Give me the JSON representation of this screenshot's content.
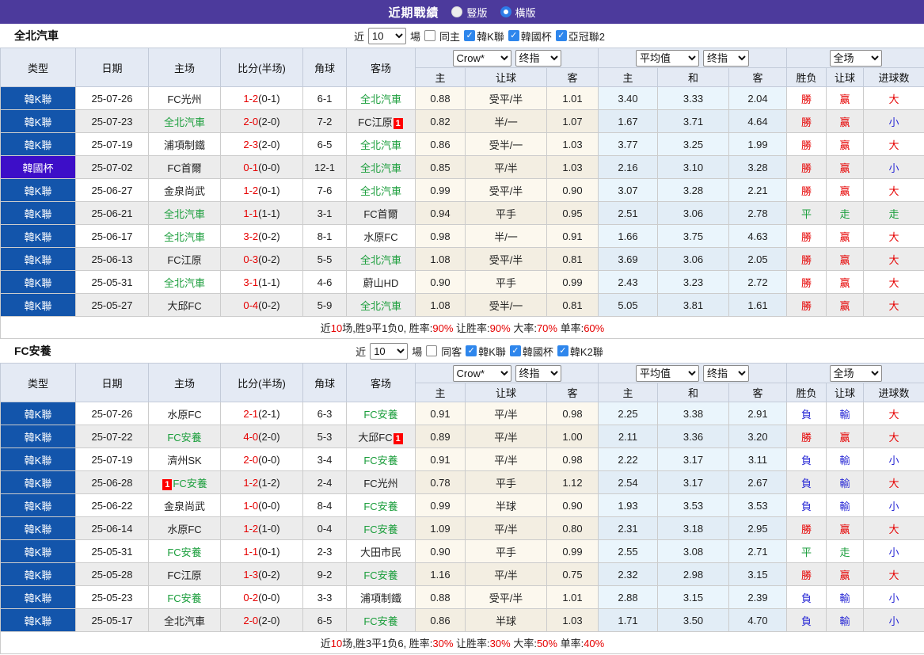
{
  "title_bar": {
    "title": "近期戰績",
    "vertical_label": "豎版",
    "horizontal_label": "橫版",
    "selected": "橫版",
    "bar_color": "#4C3A9C",
    "radio_accent": "#2D7CE8"
  },
  "selects": {
    "count": "10",
    "book": "Crow*",
    "final1": "终指",
    "avg": "平均值",
    "final2": "终指",
    "scope": "全场"
  },
  "columns": {
    "type": "类型",
    "date": "日期",
    "home": "主场",
    "score": "比分(半场)",
    "corner": "角球",
    "away": "客场",
    "sub_home": "主",
    "sub_handicap": "让球",
    "sub_away": "客",
    "sub_home2": "主",
    "sub_draw": "和",
    "sub_away2": "客",
    "sub_result": "胜负",
    "sub_hresult": "让球",
    "sub_goals": "进球数"
  },
  "colors": {
    "league_blue": "#1355AB",
    "cup_purple": "#3D0EC8",
    "win_red": "#E60000",
    "lose_blue": "#2A2AD5",
    "draw_green": "#1B9E3C",
    "handicap_col_bg": "#FCF8EE",
    "avg_col_bg": "#EAF5FC"
  },
  "tables": [
    {
      "team": "全北汽車",
      "near_label": "近",
      "games_label": "場",
      "same_label": "同主",
      "leagues": [
        "韓K聯",
        "韓國杯",
        "亞冠聯2"
      ],
      "rows": [
        {
          "league": "韓K聯",
          "date": "25-07-26",
          "home": {
            "name": "FC光州"
          },
          "score_full": "1-2",
          "score_half": "(0-1)",
          "corner": "6-1",
          "away": {
            "name": "全北汽車",
            "green": true
          },
          "crow": [
            "0.88",
            "受平/半",
            "1.01"
          ],
          "avg": [
            "3.40",
            "3.33",
            "2.04"
          ],
          "result": [
            [
              "勝",
              "r"
            ],
            [
              "赢",
              "r"
            ],
            [
              "大",
              "r"
            ]
          ]
        },
        {
          "league": "韓K聯",
          "date": "25-07-23",
          "home": {
            "name": "全北汽車",
            "green": true
          },
          "score_full": "2-0",
          "score_half": "(2-0)",
          "corner": "7-2",
          "away": {
            "name": "FC江原",
            "badge": "1",
            "badge_pos": "after"
          },
          "crow": [
            "0.82",
            "半/一",
            "1.07"
          ],
          "avg": [
            "1.67",
            "3.71",
            "4.64"
          ],
          "result": [
            [
              "勝",
              "r"
            ],
            [
              "赢",
              "r"
            ],
            [
              "小",
              "b"
            ]
          ]
        },
        {
          "league": "韓K聯",
          "date": "25-07-19",
          "home": {
            "name": "浦項制鐵"
          },
          "score_full": "2-3",
          "score_half": "(2-0)",
          "corner": "6-5",
          "away": {
            "name": "全北汽車",
            "green": true
          },
          "crow": [
            "0.86",
            "受半/一",
            "1.03"
          ],
          "avg": [
            "3.77",
            "3.25",
            "1.99"
          ],
          "result": [
            [
              "勝",
              "r"
            ],
            [
              "赢",
              "r"
            ],
            [
              "大",
              "r"
            ]
          ]
        },
        {
          "league": "韓國杯",
          "cup": true,
          "date": "25-07-02",
          "home": {
            "name": "FC首爾"
          },
          "score_full": "0-1",
          "score_half": "(0-0)",
          "corner": "12-1",
          "away": {
            "name": "全北汽車",
            "green": true
          },
          "crow": [
            "0.85",
            "平/半",
            "1.03"
          ],
          "avg": [
            "2.16",
            "3.10",
            "3.28"
          ],
          "result": [
            [
              "勝",
              "r"
            ],
            [
              "赢",
              "r"
            ],
            [
              "小",
              "b"
            ]
          ]
        },
        {
          "league": "韓K聯",
          "date": "25-06-27",
          "home": {
            "name": "金泉尚武"
          },
          "score_full": "1-2",
          "score_half": "(0-1)",
          "corner": "7-6",
          "away": {
            "name": "全北汽車",
            "green": true
          },
          "crow": [
            "0.99",
            "受平/半",
            "0.90"
          ],
          "avg": [
            "3.07",
            "3.28",
            "2.21"
          ],
          "result": [
            [
              "勝",
              "r"
            ],
            [
              "赢",
              "r"
            ],
            [
              "大",
              "r"
            ]
          ]
        },
        {
          "league": "韓K聯",
          "date": "25-06-21",
          "home": {
            "name": "全北汽車",
            "green": true
          },
          "score_full": "1-1",
          "score_half": "(1-1)",
          "corner": "3-1",
          "away": {
            "name": "FC首爾"
          },
          "crow": [
            "0.94",
            "平手",
            "0.95"
          ],
          "avg": [
            "2.51",
            "3.06",
            "2.78"
          ],
          "result": [
            [
              "平",
              "g"
            ],
            [
              "走",
              "g"
            ],
            [
              "走",
              "g"
            ]
          ]
        },
        {
          "league": "韓K聯",
          "date": "25-06-17",
          "home": {
            "name": "全北汽車",
            "green": true
          },
          "score_full": "3-2",
          "score_half": "(0-2)",
          "corner": "8-1",
          "away": {
            "name": "水原FC"
          },
          "crow": [
            "0.98",
            "半/一",
            "0.91"
          ],
          "avg": [
            "1.66",
            "3.75",
            "4.63"
          ],
          "result": [
            [
              "勝",
              "r"
            ],
            [
              "赢",
              "r"
            ],
            [
              "大",
              "r"
            ]
          ]
        },
        {
          "league": "韓K聯",
          "date": "25-06-13",
          "home": {
            "name": "FC江原"
          },
          "score_full": "0-3",
          "score_half": "(0-2)",
          "corner": "5-5",
          "away": {
            "name": "全北汽車",
            "green": true
          },
          "crow": [
            "1.08",
            "受平/半",
            "0.81"
          ],
          "avg": [
            "3.69",
            "3.06",
            "2.05"
          ],
          "result": [
            [
              "勝",
              "r"
            ],
            [
              "赢",
              "r"
            ],
            [
              "大",
              "r"
            ]
          ]
        },
        {
          "league": "韓K聯",
          "date": "25-05-31",
          "home": {
            "name": "全北汽車",
            "green": true
          },
          "score_full": "3-1",
          "score_half": "(1-1)",
          "corner": "4-6",
          "away": {
            "name": "蔚山HD"
          },
          "crow": [
            "0.90",
            "平手",
            "0.99"
          ],
          "avg": [
            "2.43",
            "3.23",
            "2.72"
          ],
          "result": [
            [
              "勝",
              "r"
            ],
            [
              "赢",
              "r"
            ],
            [
              "大",
              "r"
            ]
          ]
        },
        {
          "league": "韓K聯",
          "date": "25-05-27",
          "home": {
            "name": "大邱FC"
          },
          "score_full": "0-4",
          "score_half": "(0-2)",
          "corner": "5-9",
          "away": {
            "name": "全北汽車",
            "green": true
          },
          "crow": [
            "1.08",
            "受半/一",
            "0.81"
          ],
          "avg": [
            "5.05",
            "3.81",
            "1.61"
          ],
          "result": [
            [
              "勝",
              "r"
            ],
            [
              "赢",
              "r"
            ],
            [
              "大",
              "r"
            ]
          ]
        }
      ],
      "summary": [
        {
          "t": "近"
        },
        {
          "t": "10",
          "r": true
        },
        {
          "t": "场,胜9平1负0, 胜率:"
        },
        {
          "t": "90%",
          "r": true
        },
        {
          "t": " 让胜率:"
        },
        {
          "t": "90%",
          "r": true
        },
        {
          "t": " 大率:"
        },
        {
          "t": "70%",
          "r": true
        },
        {
          "t": " 单率:"
        },
        {
          "t": "60%",
          "r": true
        }
      ]
    },
    {
      "team": "FC安養",
      "near_label": "近",
      "games_label": "場",
      "same_label": "同客",
      "leagues": [
        "韓K聯",
        "韓國杯",
        "韓K2聯"
      ],
      "rows": [
        {
          "league": "韓K聯",
          "date": "25-07-26",
          "home": {
            "name": "水原FC"
          },
          "score_full": "2-1",
          "score_half": "(2-1)",
          "corner": "6-3",
          "away": {
            "name": "FC安養",
            "green": true
          },
          "crow": [
            "0.91",
            "平/半",
            "0.98"
          ],
          "avg": [
            "2.25",
            "3.38",
            "2.91"
          ],
          "result": [
            [
              "負",
              "b"
            ],
            [
              "輸",
              "b"
            ],
            [
              "大",
              "r"
            ]
          ]
        },
        {
          "league": "韓K聯",
          "date": "25-07-22",
          "home": {
            "name": "FC安養",
            "green": true
          },
          "score_full": "4-0",
          "score_half": "(2-0)",
          "corner": "5-3",
          "away": {
            "name": "大邱FC",
            "badge": "1",
            "badge_pos": "after"
          },
          "crow": [
            "0.89",
            "平/半",
            "1.00"
          ],
          "avg": [
            "2.11",
            "3.36",
            "3.20"
          ],
          "result": [
            [
              "勝",
              "r"
            ],
            [
              "赢",
              "r"
            ],
            [
              "大",
              "r"
            ]
          ]
        },
        {
          "league": "韓K聯",
          "date": "25-07-19",
          "home": {
            "name": "濟州SK"
          },
          "score_full": "2-0",
          "score_half": "(0-0)",
          "corner": "3-4",
          "away": {
            "name": "FC安養",
            "green": true
          },
          "crow": [
            "0.91",
            "平/半",
            "0.98"
          ],
          "avg": [
            "2.22",
            "3.17",
            "3.11"
          ],
          "result": [
            [
              "負",
              "b"
            ],
            [
              "輸",
              "b"
            ],
            [
              "小",
              "b"
            ]
          ]
        },
        {
          "league": "韓K聯",
          "date": "25-06-28",
          "home": {
            "name": "FC安養",
            "green": true,
            "badge": "1",
            "badge_pos": "before"
          },
          "score_full": "1-2",
          "score_half": "(1-2)",
          "corner": "2-4",
          "away": {
            "name": "FC光州"
          },
          "crow": [
            "0.78",
            "平手",
            "1.12"
          ],
          "avg": [
            "2.54",
            "3.17",
            "2.67"
          ],
          "result": [
            [
              "負",
              "b"
            ],
            [
              "輸",
              "b"
            ],
            [
              "大",
              "r"
            ]
          ]
        },
        {
          "league": "韓K聯",
          "date": "25-06-22",
          "home": {
            "name": "金泉尚武"
          },
          "score_full": "1-0",
          "score_half": "(0-0)",
          "corner": "8-4",
          "away": {
            "name": "FC安養",
            "green": true
          },
          "crow": [
            "0.99",
            "半球",
            "0.90"
          ],
          "avg": [
            "1.93",
            "3.53",
            "3.53"
          ],
          "result": [
            [
              "負",
              "b"
            ],
            [
              "輸",
              "b"
            ],
            [
              "小",
              "b"
            ]
          ]
        },
        {
          "league": "韓K聯",
          "date": "25-06-14",
          "home": {
            "name": "水原FC"
          },
          "score_full": "1-2",
          "score_half": "(1-0)",
          "corner": "0-4",
          "away": {
            "name": "FC安養",
            "green": true
          },
          "crow": [
            "1.09",
            "平/半",
            "0.80"
          ],
          "avg": [
            "2.31",
            "3.18",
            "2.95"
          ],
          "result": [
            [
              "勝",
              "r"
            ],
            [
              "赢",
              "r"
            ],
            [
              "大",
              "r"
            ]
          ]
        },
        {
          "league": "韓K聯",
          "date": "25-05-31",
          "home": {
            "name": "FC安養",
            "green": true
          },
          "score_full": "1-1",
          "score_half": "(0-1)",
          "corner": "2-3",
          "away": {
            "name": "大田市民"
          },
          "crow": [
            "0.90",
            "平手",
            "0.99"
          ],
          "avg": [
            "2.55",
            "3.08",
            "2.71"
          ],
          "result": [
            [
              "平",
              "g"
            ],
            [
              "走",
              "g"
            ],
            [
              "小",
              "b"
            ]
          ]
        },
        {
          "league": "韓K聯",
          "date": "25-05-28",
          "home": {
            "name": "FC江原"
          },
          "score_full": "1-3",
          "score_half": "(0-2)",
          "corner": "9-2",
          "away": {
            "name": "FC安養",
            "green": true
          },
          "crow": [
            "1.16",
            "平/半",
            "0.75"
          ],
          "avg": [
            "2.32",
            "2.98",
            "3.15"
          ],
          "result": [
            [
              "勝",
              "r"
            ],
            [
              "赢",
              "r"
            ],
            [
              "大",
              "r"
            ]
          ]
        },
        {
          "league": "韓K聯",
          "date": "25-05-23",
          "home": {
            "name": "FC安養",
            "green": true
          },
          "score_full": "0-2",
          "score_half": "(0-0)",
          "corner": "3-3",
          "away": {
            "name": "浦項制鐵"
          },
          "crow": [
            "0.88",
            "受平/半",
            "1.01"
          ],
          "avg": [
            "2.88",
            "3.15",
            "2.39"
          ],
          "result": [
            [
              "負",
              "b"
            ],
            [
              "輸",
              "b"
            ],
            [
              "小",
              "b"
            ]
          ]
        },
        {
          "league": "韓K聯",
          "date": "25-05-17",
          "home": {
            "name": "全北汽車"
          },
          "score_full": "2-0",
          "score_half": "(2-0)",
          "corner": "6-5",
          "away": {
            "name": "FC安養",
            "green": true
          },
          "crow": [
            "0.86",
            "半球",
            "1.03"
          ],
          "avg": [
            "1.71",
            "3.50",
            "4.70"
          ],
          "result": [
            [
              "負",
              "b"
            ],
            [
              "輸",
              "b"
            ],
            [
              "小",
              "b"
            ]
          ]
        }
      ],
      "summary": [
        {
          "t": "近"
        },
        {
          "t": "10",
          "r": true
        },
        {
          "t": "场,胜3平1负6, 胜率:"
        },
        {
          "t": "30%",
          "r": true
        },
        {
          "t": " 让胜率:"
        },
        {
          "t": "30%",
          "r": true
        },
        {
          "t": " 大率:"
        },
        {
          "t": "50%",
          "r": true
        },
        {
          "t": " 单率:"
        },
        {
          "t": "40%",
          "r": true
        }
      ]
    }
  ]
}
